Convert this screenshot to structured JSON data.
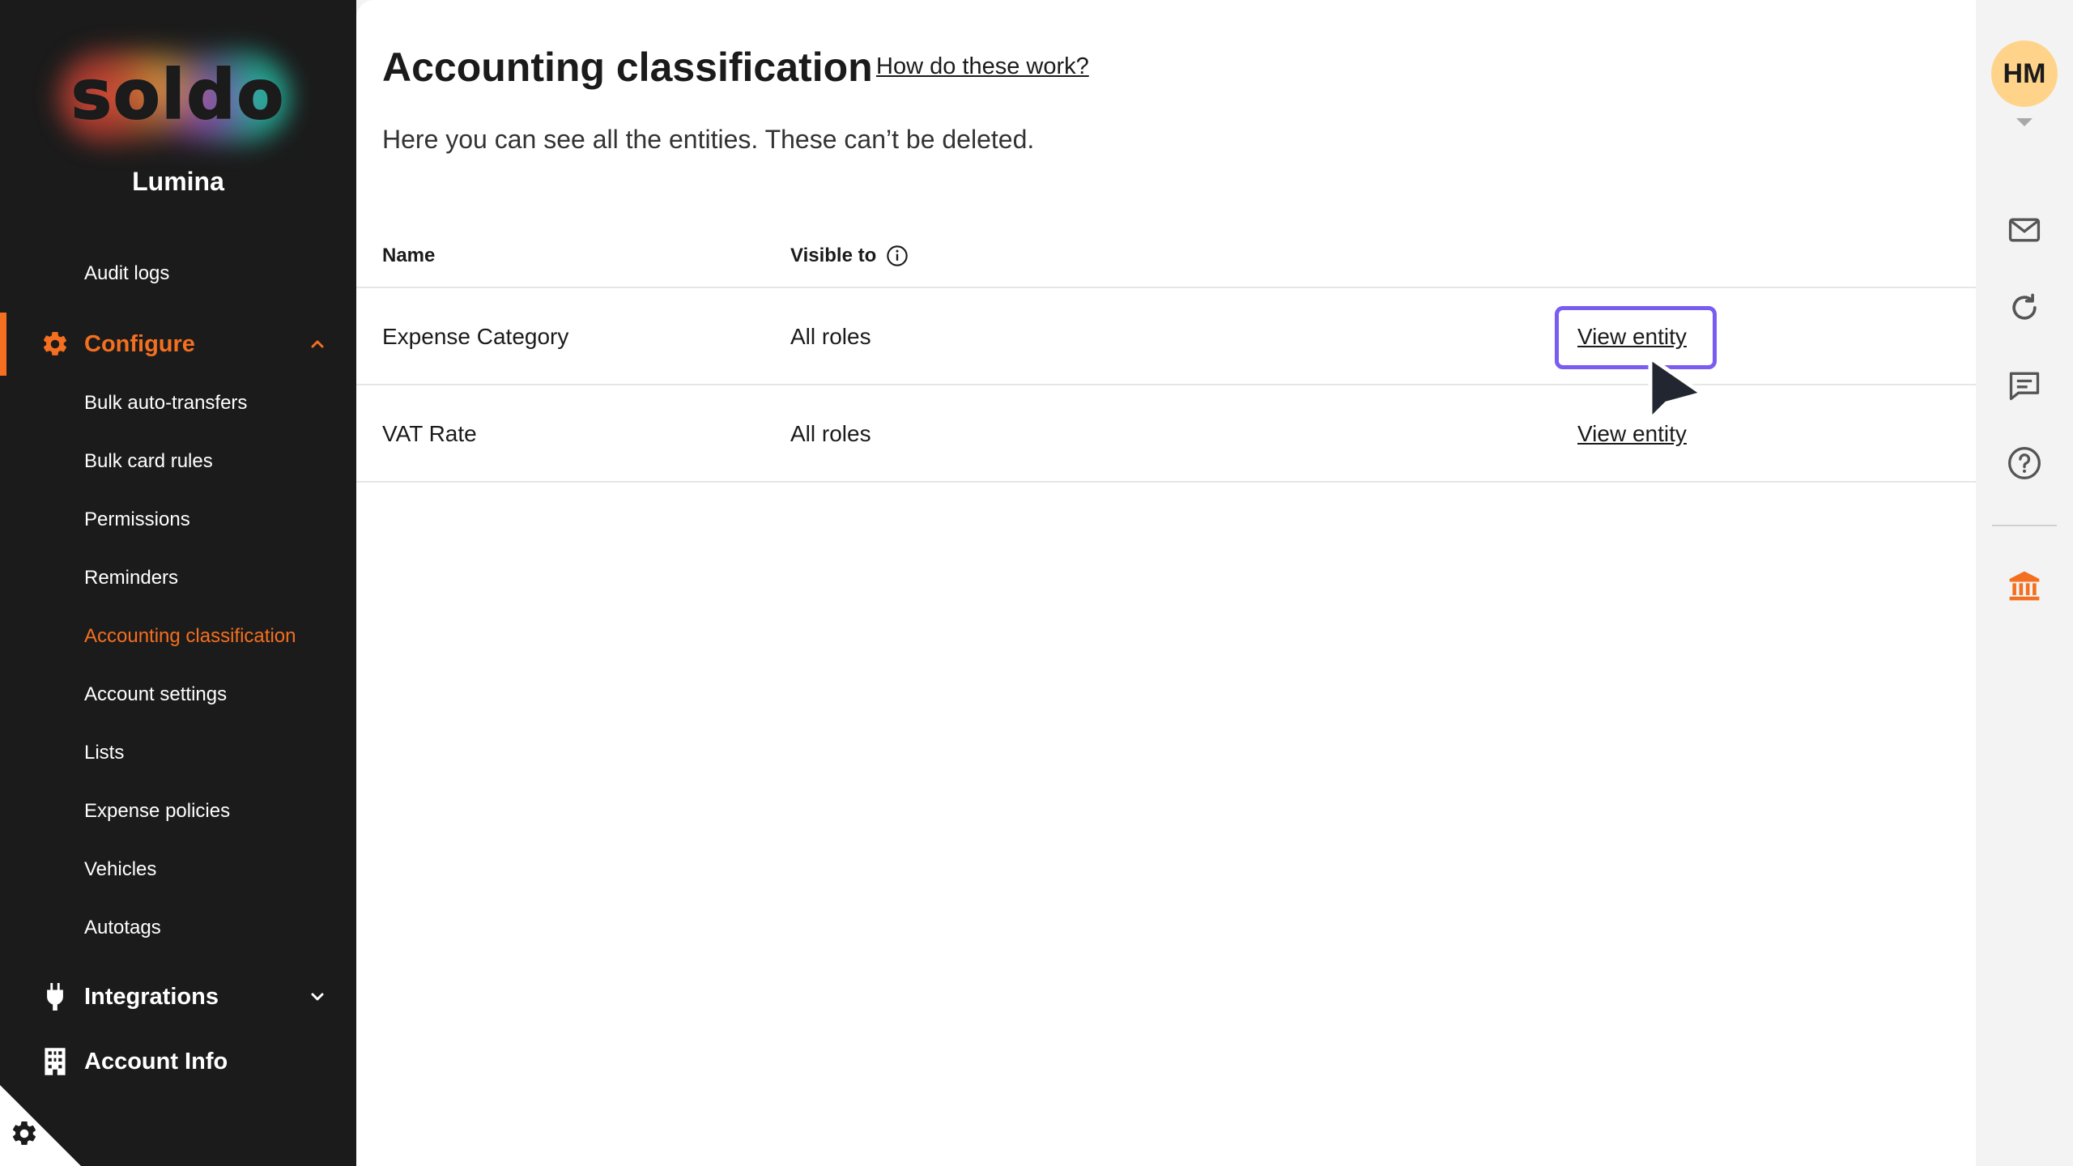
{
  "sidebar": {
    "logo_text": "soldo",
    "org_name": "Lumina",
    "items": [
      {
        "label": "Audit logs"
      },
      {
        "label": "Configure"
      },
      {
        "label": "Bulk auto-transfers"
      },
      {
        "label": "Bulk card rules"
      },
      {
        "label": "Permissions"
      },
      {
        "label": "Reminders"
      },
      {
        "label": "Accounting classification"
      },
      {
        "label": "Account settings"
      },
      {
        "label": "Lists"
      },
      {
        "label": "Expense policies"
      },
      {
        "label": "Vehicles"
      },
      {
        "label": "Autotags"
      },
      {
        "label": "Integrations"
      },
      {
        "label": "Account Info"
      }
    ],
    "active_item": "Accounting classification",
    "accent_color": "#f46f20"
  },
  "main": {
    "title": "Accounting classification",
    "help_link": "How do these work?",
    "description": "Here you can see all the entities. These can’t be deleted.",
    "table": {
      "columns": [
        "Name",
        "Visible to"
      ],
      "rows": [
        {
          "name": "Expense Category",
          "visible_to": "All roles",
          "action": "View entity"
        },
        {
          "name": "VAT Rate",
          "visible_to": "All roles",
          "action": "View entity"
        }
      ]
    }
  },
  "rail": {
    "avatar_initials": "HM",
    "icons": [
      "mail-icon",
      "refresh-icon",
      "chat-icon",
      "help-icon",
      "bank-icon"
    ]
  }
}
